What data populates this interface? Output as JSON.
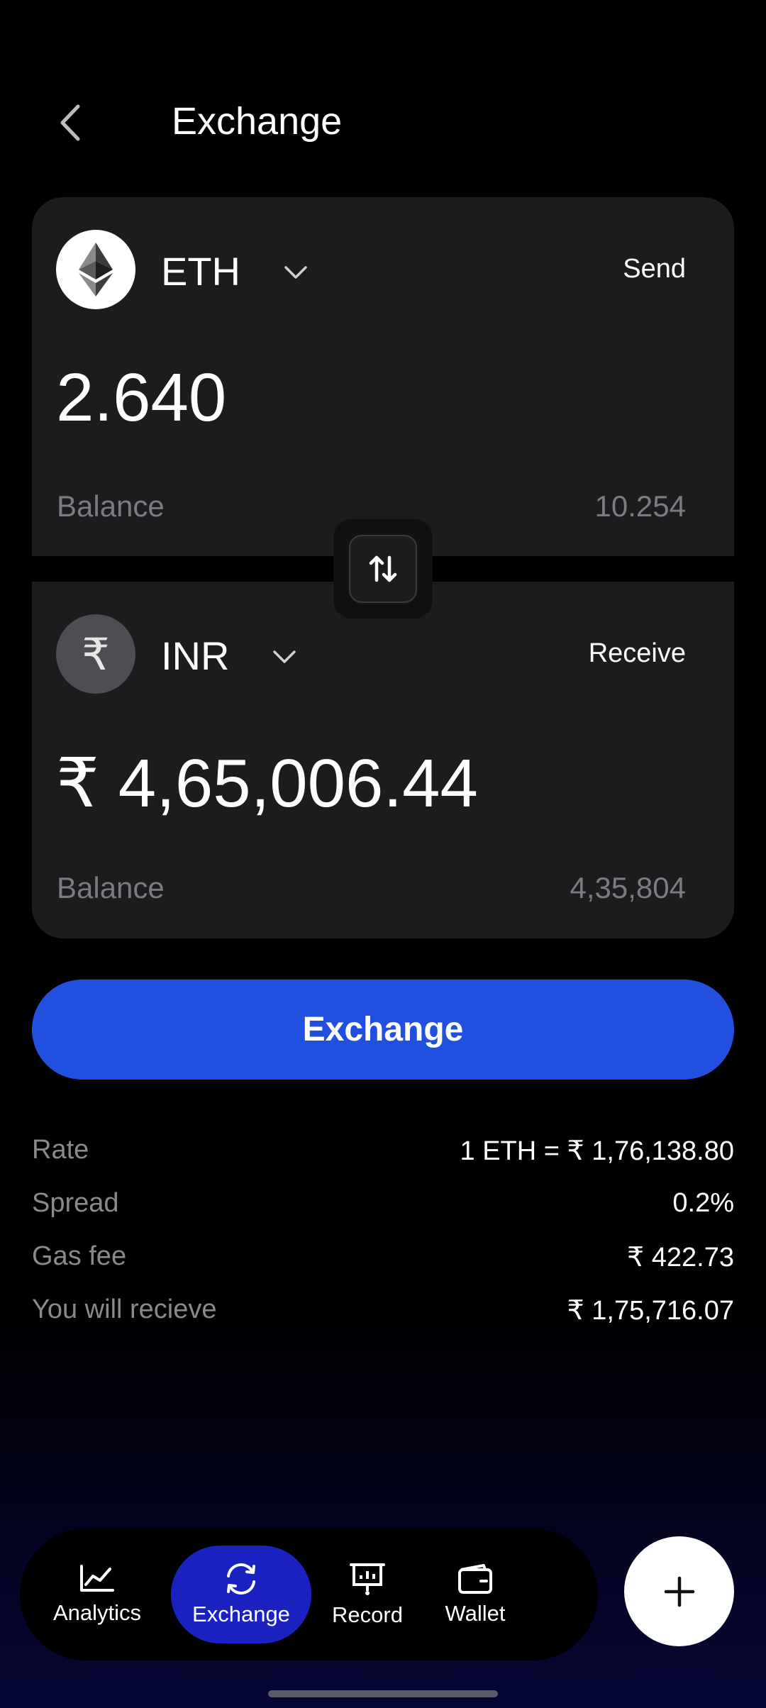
{
  "header": {
    "title": "Exchange"
  },
  "send": {
    "symbol": "ETH",
    "role": "Send",
    "amount": "2.640",
    "balance_label": "Balance",
    "balance_value": "10.254"
  },
  "receive": {
    "symbol": "INR",
    "coin_glyph": "₹",
    "role": "Receive",
    "amount": "₹ 4,65,006.44",
    "balance_label": "Balance",
    "balance_value": "4,35,804"
  },
  "exchange_button": "Exchange",
  "details": [
    {
      "label": "Rate",
      "value": "1 ETH = ₹ 1,76,138.80"
    },
    {
      "label": "Spread",
      "value": "0.2%"
    },
    {
      "label": "Gas fee",
      "value": "₹ 422.73"
    },
    {
      "label": "You will recieve",
      "value": "₹ 1,75,716.07"
    }
  ],
  "tabs": [
    {
      "label": "Analytics",
      "icon": "analytics-icon"
    },
    {
      "label": "Exchange",
      "icon": "exchange-icon",
      "active": true
    },
    {
      "label": "Record",
      "icon": "record-icon"
    },
    {
      "label": "Wallet",
      "icon": "wallet-icon"
    }
  ],
  "fab_icon": "plus-icon",
  "colors": {
    "accent": "#2150df",
    "active_tab": "#1b22c2",
    "card": "#1c1c1f"
  }
}
